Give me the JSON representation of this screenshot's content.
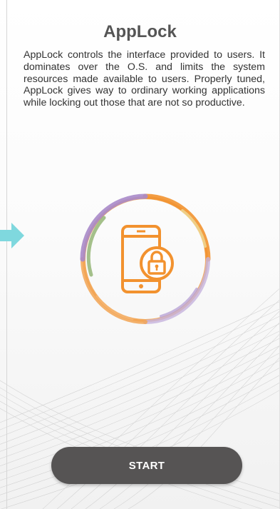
{
  "app": {
    "title": "AppLock",
    "description": "AppLock controls the interface provided to users. It dominates over the O.S. and limits the system resources made available to users. Properly tuned, AppLock gives way to ordinary working applications while locking out those that are not so productive.",
    "start_label": "START"
  },
  "icons": {
    "logo": "phone-lock-icon",
    "indicator": "arrow-right-icon"
  },
  "colors": {
    "title": "#555555",
    "body_text": "#333333",
    "button_bg": "#565454",
    "button_text": "#ffffff",
    "accent_orange": "#f2922f",
    "ring_purple": "#a98ac9",
    "ring_green": "#8fb26e",
    "arrow": "#7fd8de"
  }
}
